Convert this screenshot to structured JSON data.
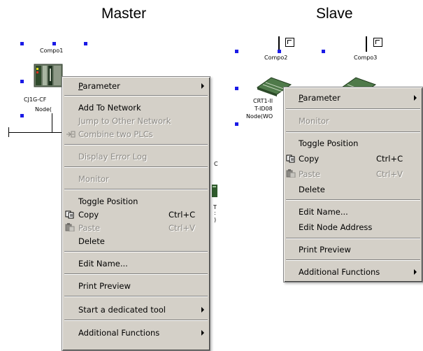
{
  "headings": {
    "master": "Master",
    "slave": "Slave"
  },
  "network": {
    "compo1": "Compo1",
    "compo2": "Compo2",
    "compo3": "Compo3",
    "master_node_name": "CJ1G-CF",
    "master_node_sub": "Node(",
    "slave_node_name": "CRT1-II",
    "slave_node_type": "T-ID08",
    "slave_node_sub": "Node(WO",
    "hidden_c": "C",
    "hidden_t": "T",
    "hidden_colon": ":",
    "hidden_paren": ")"
  },
  "master_menu": {
    "items": [
      {
        "label": "Parameter",
        "mnemonic": "P",
        "enabled": true,
        "submenu": true
      },
      {
        "label": "Add To Network",
        "enabled": true
      },
      {
        "label": "Jump to Other Network",
        "enabled": false
      },
      {
        "label": "Combine two PLCs",
        "enabled": false,
        "icon": "combine-plcs-icon"
      },
      {
        "label": "Display Error Log",
        "enabled": false
      },
      {
        "label": "Monitor",
        "enabled": false
      },
      {
        "label": "Toggle Position",
        "enabled": true
      },
      {
        "label": "Copy",
        "shortcut": "Ctrl+C",
        "enabled": true,
        "icon": "copy-icon"
      },
      {
        "label": "Paste",
        "shortcut": "Ctrl+V",
        "enabled": false,
        "icon": "paste-icon"
      },
      {
        "label": "Delete",
        "enabled": true
      },
      {
        "label": "Edit Name...",
        "enabled": true
      },
      {
        "label": "Print Preview",
        "enabled": true
      },
      {
        "label": "Start a dedicated tool",
        "enabled": true,
        "submenu": true
      },
      {
        "label": "Additional Functions",
        "enabled": true,
        "submenu": true
      }
    ]
  },
  "slave_menu": {
    "items": [
      {
        "label": "Parameter",
        "enabled": true,
        "submenu": true
      },
      {
        "label": "Monitor",
        "enabled": false
      },
      {
        "label": "Toggle Position",
        "enabled": true
      },
      {
        "label": "Copy",
        "shortcut": "Ctrl+C",
        "enabled": true,
        "icon": "copy-icon"
      },
      {
        "label": "Paste",
        "shortcut": "Ctrl+V",
        "enabled": false,
        "icon": "paste-icon"
      },
      {
        "label": "Delete",
        "enabled": true
      },
      {
        "label": "Edit Name...",
        "enabled": true
      },
      {
        "label": "Edit Node Address",
        "enabled": true
      },
      {
        "label": "Print Preview",
        "enabled": true
      },
      {
        "label": "Additional Functions",
        "enabled": true,
        "submenu": true
      }
    ]
  },
  "colors": {
    "menu_bg": "#d4d0c8",
    "handle": "#1a1ae6",
    "disabled_text": "#8c8a85"
  }
}
